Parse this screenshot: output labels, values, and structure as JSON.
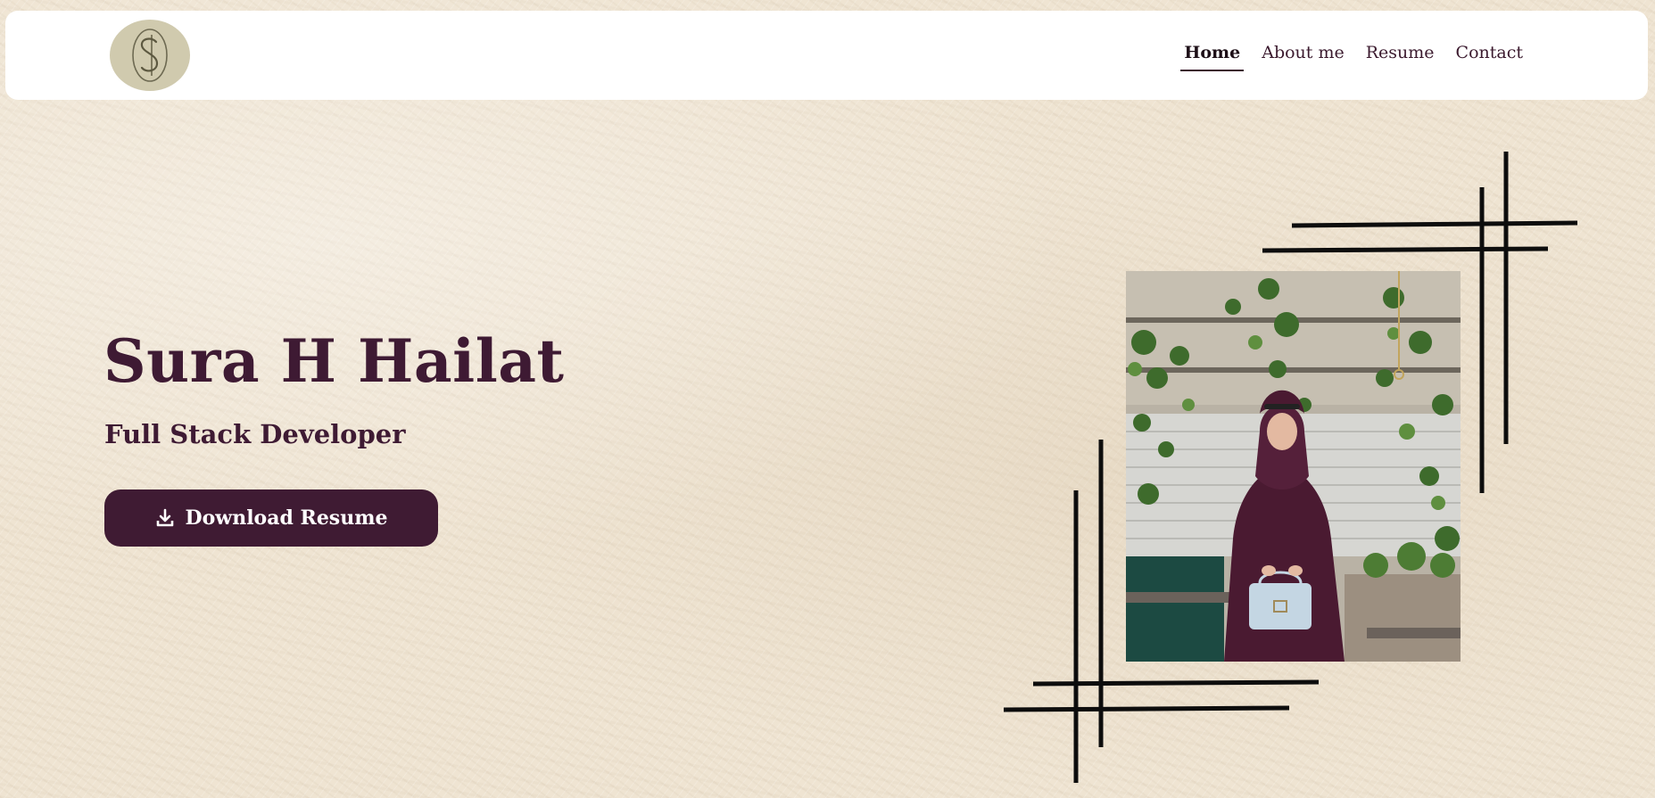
{
  "nav": {
    "items": [
      {
        "label": "Home",
        "active": true
      },
      {
        "label": "About me",
        "active": false
      },
      {
        "label": "Resume",
        "active": false
      },
      {
        "label": "Contact",
        "active": false
      }
    ]
  },
  "logo": {
    "icon": "monogram-s-icon"
  },
  "hero": {
    "name": "Sura H Hailat",
    "role": "Full Stack Developer",
    "download_label": "Download Resume",
    "download_icon": "download-icon"
  },
  "photo": {
    "subject": "profile-photo"
  },
  "colors": {
    "accent": "#3f1b33",
    "background": "#efe4d2",
    "logo_bg": "#d0caae",
    "header_bg": "#ffffff"
  }
}
